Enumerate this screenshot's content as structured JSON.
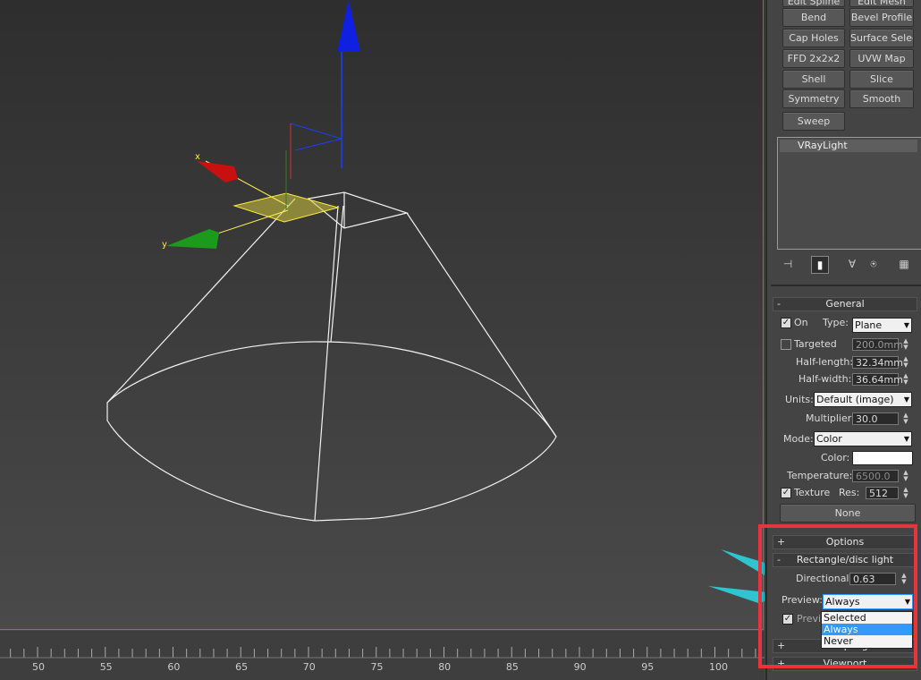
{
  "modifiers": {
    "top_row": [
      "Edit Spline",
      "Edit Mesh"
    ],
    "rows": [
      [
        "Bend",
        "Bevel Profile"
      ],
      [
        "Cap Holes",
        "Surface Select"
      ],
      [
        "FFD 2x2x2",
        "UVW Map"
      ],
      [
        "Shell",
        "Slice"
      ],
      [
        "Symmetry",
        "Smooth"
      ],
      [
        "Sweep"
      ]
    ]
  },
  "stack": {
    "item": "VRayLight"
  },
  "stack_toolbar": [
    "pin-stack-icon",
    "show-end-result-icon",
    "make-unique-icon",
    "remove-modifier-icon",
    "configure-sets-icon"
  ],
  "general": {
    "title": "General",
    "sign": "-",
    "on_label": "On",
    "on_checked": true,
    "type_label": "Type:",
    "type_value": "Plane",
    "targeted_label": "Targeted",
    "targeted_checked": false,
    "targeted_value": "200.0mm",
    "half_length_label": "Half-length:",
    "half_length_value": "32.34mm",
    "half_width_label": "Half-width:",
    "half_width_value": "36.64mm",
    "units_label": "Units:",
    "units_value": "Default (image)",
    "multiplier_label": "Multiplier:",
    "multiplier_value": "30.0",
    "mode_label": "Mode:",
    "mode_value": "Color",
    "color_label": "Color:",
    "color_value": "#ffffff",
    "temperature_label": "Temperature:",
    "temperature_value": "6500.0",
    "texture_label": "Texture",
    "texture_checked": true,
    "res_label": "Res:",
    "res_value": "512",
    "none_button": "None"
  },
  "options": {
    "title": "Options",
    "sign": "+"
  },
  "rect_disc": {
    "title": "Rectangle/disc light",
    "sign": "-",
    "directional_label": "Directional:",
    "directional_value": "0.63",
    "preview_label": "Preview:",
    "preview_value": "Always",
    "preview_options": [
      "Selected",
      "Always",
      "Never"
    ],
    "preview_selected_index": 1,
    "preview_checkbox_label": "Previ"
  },
  "sampling": {
    "title": "Sampling",
    "sign": "+"
  },
  "viewport_rollout": {
    "title": "Viewport",
    "sign": "+"
  },
  "timeline": {
    "ticks": [
      "50",
      "55",
      "60",
      "65",
      "70",
      "75",
      "80",
      "85",
      "90",
      "95",
      "100"
    ]
  },
  "gizmo": {
    "x_label": "x",
    "y_label": "y"
  },
  "colors": {
    "accent_red": "#e8343c",
    "arrow_cyan": "#2ec4d0",
    "selection_blue": "#3399ff"
  }
}
